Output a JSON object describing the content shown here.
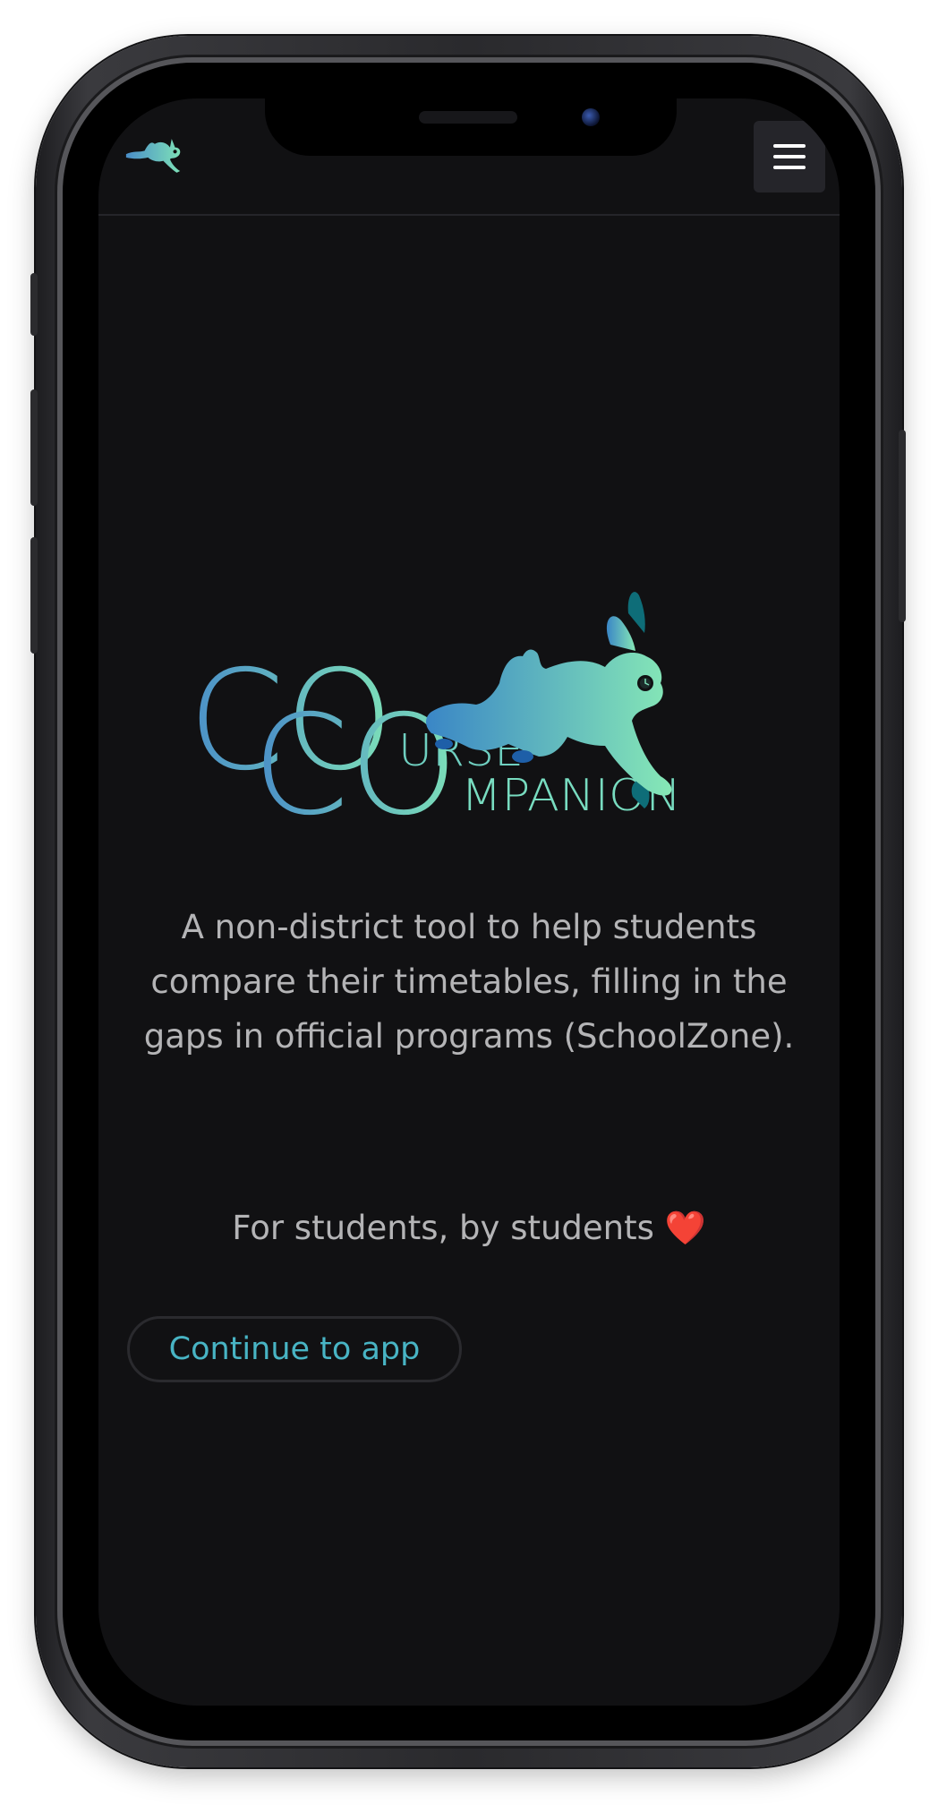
{
  "header": {
    "menu_icon": "hamburger-icon",
    "logo_icon": "rabbit-logo-icon"
  },
  "hero": {
    "logo_line1_big": "CO",
    "logo_line1_small": "URSE",
    "logo_line2_big": "CO",
    "logo_line2_small": "MPANION",
    "description": "A non-district tool to help students compare their timetables, filling in the gaps in official programs (SchoolZone).",
    "tagline": "For students, by students",
    "tagline_emoji": "❤️"
  },
  "actions": {
    "continue_label": "Continue to app"
  },
  "colors": {
    "background": "#111113",
    "accent": "#48b4c4",
    "gradient_start": "#4a8ec8",
    "gradient_end": "#7de0b8",
    "text": "#b4b4b6"
  }
}
